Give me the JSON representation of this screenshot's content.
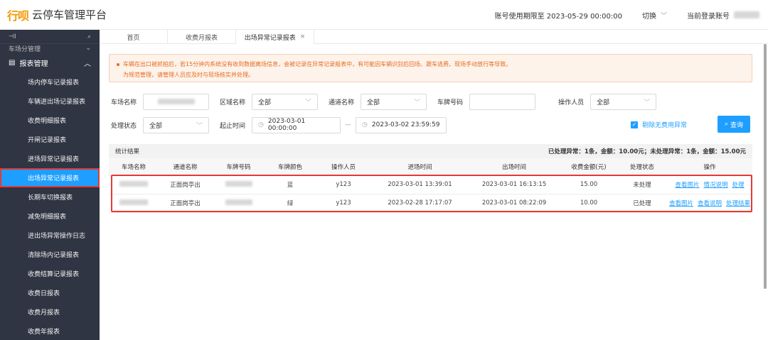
{
  "header": {
    "logo_mark": "行呗",
    "logo_text": "云停车管理平台",
    "expiry": "账号使用期限至 2023-05-29 00:00:00",
    "switch_label": "切换",
    "user_label": "当前登录账号"
  },
  "sidebar": {
    "top_label": "⊣I",
    "top_icon": "⌕",
    "cut_label": "车场分管理",
    "group": "报表管理",
    "items": [
      {
        "label": "场内停车记录报表"
      },
      {
        "label": "车辆进出场记录报表"
      },
      {
        "label": "收费明细报表"
      },
      {
        "label": "开闸记录报表"
      },
      {
        "label": "进场异常记录报表"
      },
      {
        "label": "出场异常记录报表",
        "active": true
      },
      {
        "label": "长期车切换报表"
      },
      {
        "label": "减免明细报表"
      },
      {
        "label": "进出场异常操作日志"
      },
      {
        "label": "清除场内记录报表"
      },
      {
        "label": "收费结算记录报表"
      },
      {
        "label": "收费日报表"
      },
      {
        "label": "收费月报表"
      },
      {
        "label": "收费年报表"
      }
    ]
  },
  "tabs": [
    {
      "label": "首页"
    },
    {
      "label": "收费月报表"
    },
    {
      "label": "出场异常记录报表",
      "active": true,
      "close": "×"
    }
  ],
  "notice": {
    "line1": "车辆在出口被抓拍后，若15分钟内系统没有收到数据离场信息，会被记录在异常记录报表中，有可能因车辆识别后回场、跟车逃费、现场手动放行等导致。",
    "line2": "为规范管理，请管理人员应及时与现场核实并处理。"
  },
  "filters": {
    "lot_label": "车场名称",
    "area_label": "区域名称",
    "area_value": "全部",
    "channel_label": "通道名称",
    "channel_value": "全部",
    "plate_label": "车牌号码",
    "operator_label": "操作人员",
    "operator_value": "全部",
    "status_label": "处理状态",
    "status_value": "全部",
    "time_label": "起止时间",
    "start_time": "2023-03-01 00:00:00",
    "time_sep": "—",
    "end_time": "2023-03-02 23:59:59",
    "exclude_label": "剔除无费用异常",
    "query_label": "查询"
  },
  "stats": {
    "title": "统计结果",
    "summary": "已处理异常：1条，金额：10.00元；未处理异常：1条，金额：15.00元"
  },
  "table": {
    "headers": [
      "车场名称",
      "通道名称",
      "车牌号码",
      "车牌颜色",
      "操作人员",
      "进场时间",
      "出场时间",
      "收费金额(元)",
      "处理状态",
      "操作"
    ],
    "rows": [
      {
        "channel": "正面岗亭出",
        "color": "蓝",
        "operator": "y123",
        "enter": "2023-03-01 13:39:01",
        "exit": "2023-03-01 16:13:15",
        "amount": "15.00",
        "status": "未处理",
        "actions": [
          "查看图片",
          "情况说明",
          "处理"
        ]
      },
      {
        "channel": "正面岗亭出",
        "color": "绿",
        "operator": "y123",
        "enter": "2023-02-28 17:17:07",
        "exit": "2023-03-01 08:22:09",
        "amount": "10.00",
        "status": "已处理",
        "actions": [
          "查看图片",
          "查看说明",
          "处理结果"
        ]
      }
    ]
  },
  "colors": {
    "accent": "#1e9fff",
    "sidebar_bg": "#2f3542",
    "notice_text": "#e66b1f",
    "highlight": "#e53935",
    "logo": "#f39800"
  }
}
